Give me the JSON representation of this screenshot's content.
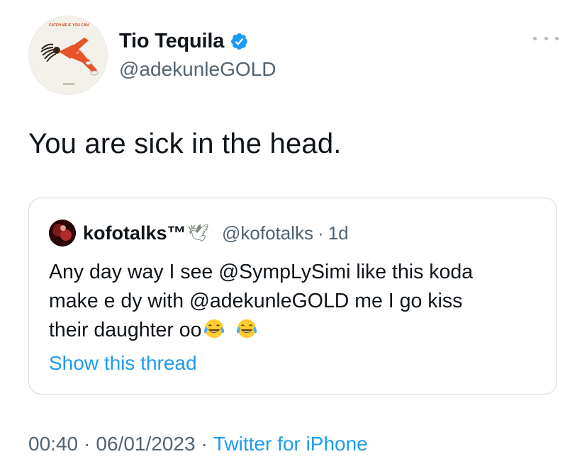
{
  "tweet": {
    "author": {
      "display_name": "Tio Tequila",
      "handle": "@adekunleGOLD",
      "verified": true,
      "avatar_caption": "CATCH ME IF YOU CAN"
    },
    "text": "You are sick in the head.",
    "more_icon": "more-horizontal-icon"
  },
  "quote": {
    "author_name": "kofotalks™",
    "author_suffix_emoji": "🕊",
    "handle": "@kofotalks",
    "separator": "·",
    "time": "1d",
    "body_lines": [
      "Any day way I see @SympLySimi like this koda",
      "make e dy with @adekunleGOLD me I go kiss",
      "their daughter oo"
    ],
    "emoji": "face-with-tears-of-joy",
    "show_thread": "Show this thread"
  },
  "meta": {
    "time": "00:40",
    "date": "06/01/2023",
    "separator": "·",
    "source": "Twitter for iPhone"
  },
  "colors": {
    "text": "#0f1419",
    "secondary": "#536471",
    "link": "#1d9bf0",
    "border": "#cfd9de",
    "verified": "#1d9bf0"
  }
}
